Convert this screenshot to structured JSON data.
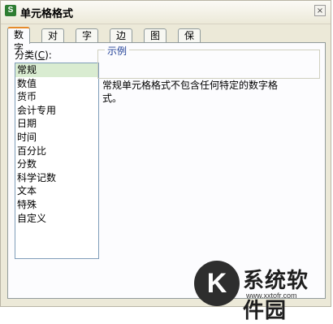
{
  "window": {
    "title": "单元格格式",
    "app_icon_letter": "S",
    "close_glyph": "×"
  },
  "tabs": [
    {
      "label": "数字",
      "active": true
    },
    {
      "label": "对齐"
    },
    {
      "label": "字体"
    },
    {
      "label": "边框"
    },
    {
      "label": "图案"
    },
    {
      "label": "保护"
    }
  ],
  "category": {
    "label_prefix": "分类(",
    "label_hotkey": "C",
    "label_suffix": "):",
    "items": [
      "常规",
      "数值",
      "货币",
      "会计专用",
      "日期",
      "时间",
      "百分比",
      "分数",
      "科学记数",
      "文本",
      "特殊",
      "自定义"
    ],
    "selected": "常规"
  },
  "sample": {
    "legend": "示例"
  },
  "description": "常规单元格格式不包含任何特定的数字格式。",
  "watermark": {
    "badge": "K",
    "text": "系统软件园",
    "url": "www.xxtofr.com"
  }
}
